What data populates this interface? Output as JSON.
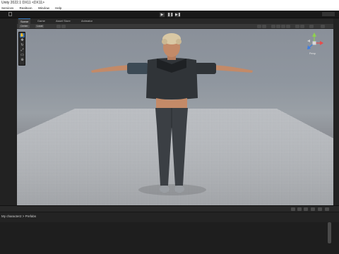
{
  "window": {
    "title": "Unity 2022.1 DX11 <DX11>"
  },
  "menu": {
    "items": [
      "Services",
      "Realtoon",
      "Window",
      "Help"
    ]
  },
  "playbar": {
    "play": "▶",
    "pause": "❚❚",
    "step": "▶❚"
  },
  "tabs": [
    "Scene",
    "Game",
    "Asset Store",
    "Animator"
  ],
  "scene_toolbar": {
    "draw_mode": "Center",
    "pivot": "Local",
    "persp_label": "Persp"
  },
  "colors": {
    "accent": "#3a79bb",
    "skin": "#c38a68",
    "hair": "#d9c8a4",
    "top": "#303438",
    "pants": "#3b3f44"
  },
  "breadcrumb": {
    "text": "My character2 > Prefabs"
  }
}
